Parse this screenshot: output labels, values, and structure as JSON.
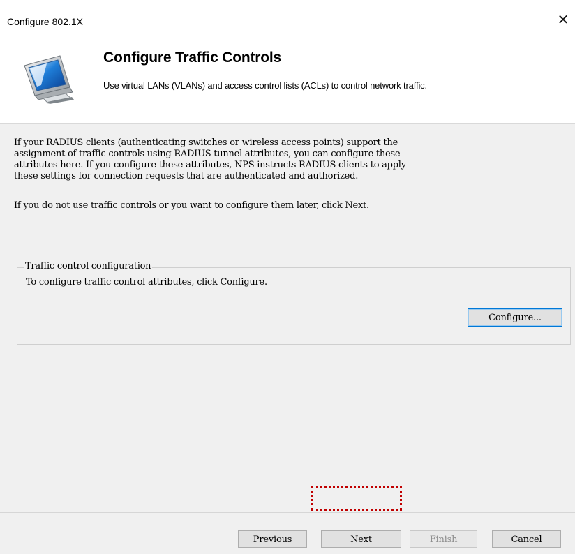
{
  "window": {
    "title": "Configure 802.1X",
    "close_glyph": "✕",
    "close_icon": "close-icon"
  },
  "header": {
    "title": "Configure Traffic Controls",
    "subtitle": "Use virtual LANs (VLANs) and access control lists (ACLs) to control network traffic.",
    "icon": "network-monitor-icon"
  },
  "content": {
    "paragraph_1_lines": [
      "If your RADIUS clients (authenticating switches or wireless access points) support the",
      "assignment of traffic controls using RADIUS tunnel attributes, you can configure these",
      "attributes here. If you configure these attributes, NPS instructs RADIUS clients to apply",
      "these settings for connection requests that are authenticated and authorized."
    ],
    "paragraph_2": "If you do not use traffic controls or you want to configure them later, click Next.",
    "group": {
      "legend": "Traffic control configuration",
      "text": "To configure traffic control attributes, click Configure.",
      "configure_label": "Configure..."
    }
  },
  "footer": {
    "previous_label": "Previous",
    "next_label": "Next",
    "finish_label": "Finish",
    "cancel_label": "Cancel"
  },
  "colors": {
    "highlight": "#c00000",
    "focus_border": "#0078d7",
    "disabled_text": "#8d8d8d"
  }
}
